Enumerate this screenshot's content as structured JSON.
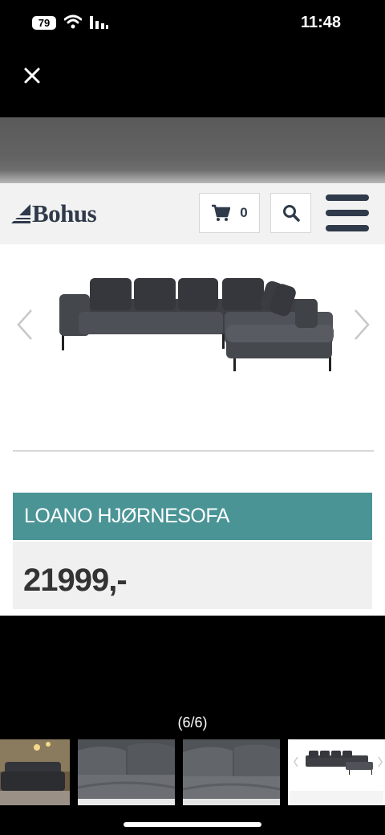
{
  "status_bar": {
    "battery": "79",
    "time": "11:48",
    "icons": [
      "battery-icon",
      "wifi-icon",
      "signal-icon"
    ]
  },
  "viewer": {
    "close_icon": "close-icon",
    "counter": "(6/6)"
  },
  "site": {
    "logo_text": "Bohus",
    "cart_count": "0",
    "cart_icon": "cart-icon",
    "search_icon": "search-icon",
    "menu_icon": "hamburger-menu-icon",
    "brand_color": "#2f3a4a"
  },
  "product": {
    "title": "LOANO HJØRNESOFA",
    "price": "21999,-",
    "title_bar_color": "#4b9496",
    "image": "corner-sofa-image",
    "prev_icon": "chevron-left-icon",
    "next_icon": "chevron-right-icon"
  },
  "thumbnails": [
    "thumb-room-scene",
    "thumb-cushion-closeup",
    "thumb-seat-closeup",
    "thumb-product-page"
  ]
}
